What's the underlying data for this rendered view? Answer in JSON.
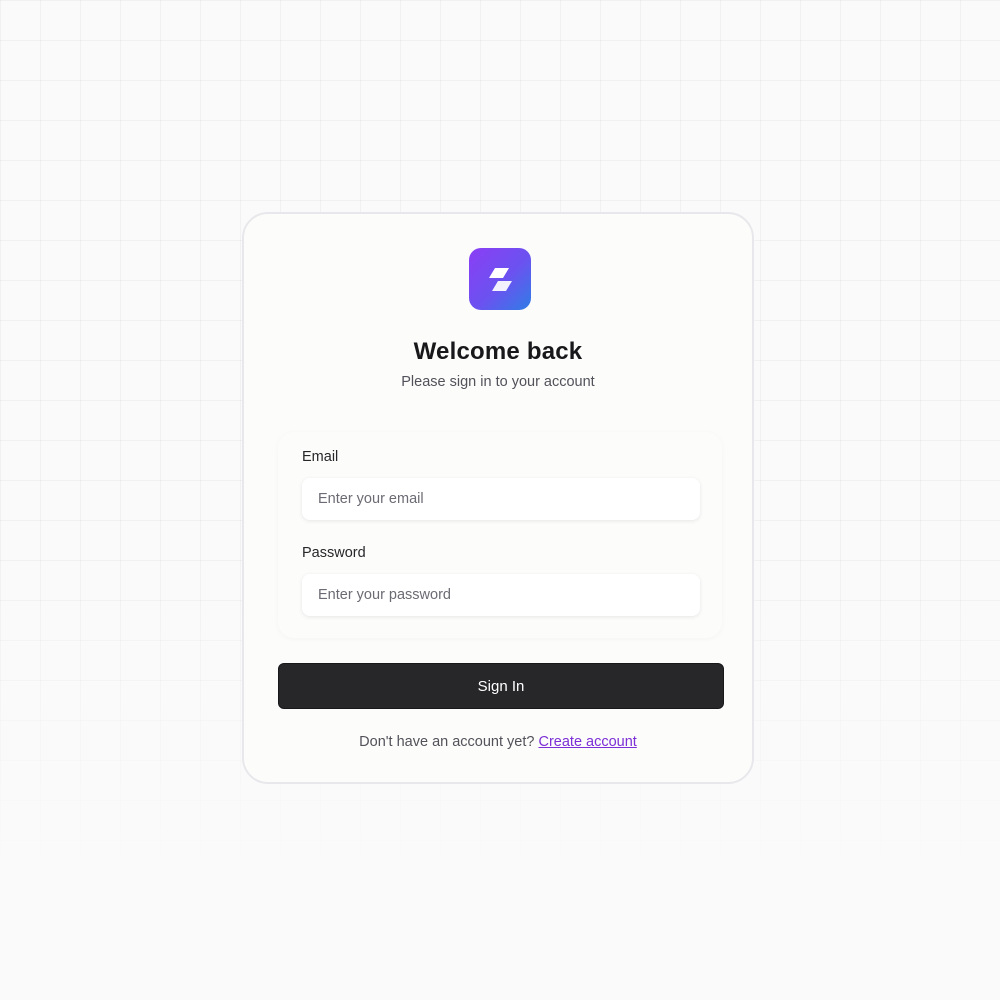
{
  "login": {
    "title": "Welcome back",
    "subtitle": "Please sign in to your account",
    "email": {
      "label": "Email",
      "placeholder": "Enter your email",
      "value": ""
    },
    "password": {
      "label": "Password",
      "placeholder": "Enter your password",
      "value": ""
    },
    "submit_label": "Sign In",
    "footer": {
      "prompt": "Don't have an account yet?",
      "link_label": "Create account"
    }
  },
  "logo": {
    "icon": "parallelogram-stack-icon",
    "gradient_start": "#8b3ef5",
    "gradient_end": "#2f7de6"
  },
  "colors": {
    "button_bg": "#27272a",
    "link": "#7c2fd6",
    "background": "#fafafa"
  }
}
